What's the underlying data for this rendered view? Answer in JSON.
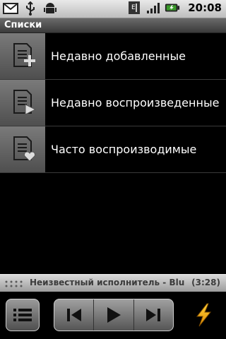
{
  "status": {
    "time": "20:08"
  },
  "title": "Списки",
  "lists": [
    {
      "label": "Недавно добавленные",
      "icon": "playlist-add-icon"
    },
    {
      "label": "Недавно воспроизведенные",
      "icon": "playlist-play-icon"
    },
    {
      "label": "Часто воспроизводимые",
      "icon": "playlist-heart-icon"
    }
  ],
  "now_playing": {
    "text": "Неизвестный исполнитель - Blu",
    "time": "(3:28)"
  }
}
